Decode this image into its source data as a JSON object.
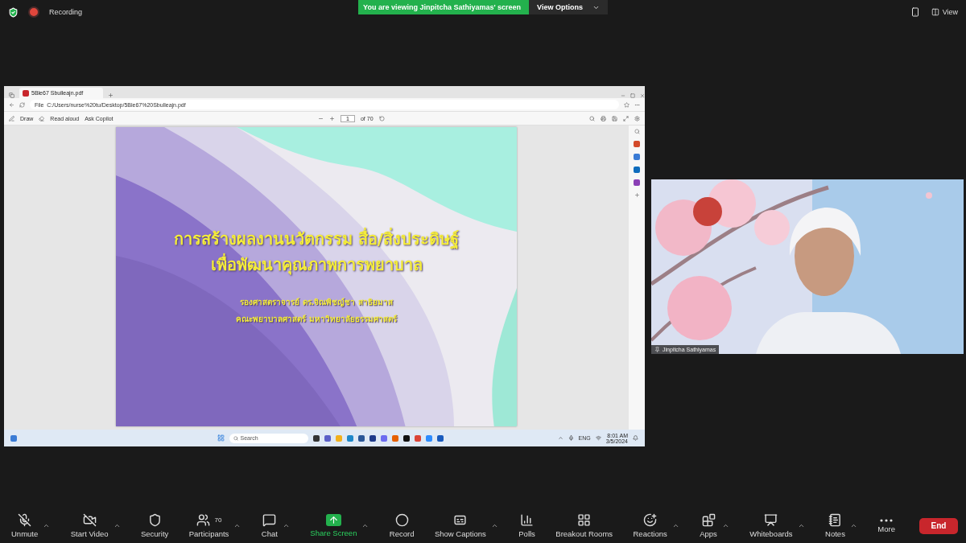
{
  "top_bar": {
    "recording_label": "Recording",
    "viewing_banner": "You are viewing Jinpitcha Sathiyamas' screen",
    "view_options": "View Options",
    "view_button": "View"
  },
  "shared_screen": {
    "browser": {
      "tab_title": "5Ble67 Sbulleajn.pdf",
      "address_prefix": "File",
      "address": "C:/Users/nurse%20tu/Desktop/5Ble67%20Sbulleajn.pdf",
      "draw": "Draw",
      "read_aloud": "Read aloud",
      "ask_copilot": "Ask Copilot",
      "page": "1",
      "page_total": "of 70"
    },
    "slide": {
      "title_lines": [
        "การสร้างผลงานนวัตกรรม สื่อ/สิ่งประดิษฐ์",
        "เพื่อพัฒนาคุณภาพการพยาบาล"
      ],
      "author": "รองศาสตราจารย์ ดร.จิณพิชญ์ชา  สาธิยมาส",
      "faculty": "คณะพยาบาลศาสตร์ มหาวิทยาลัยธรรมศาสตร์"
    },
    "taskbar": {
      "search_placeholder": "Search",
      "language": "ENG",
      "time": "8:01 AM",
      "date": "3/5/2024"
    }
  },
  "video": {
    "kind": "picture",
    "name": "Jinpitcha Sathiyamas"
  },
  "toolbar": {
    "items": [
      {
        "label": "Unmute",
        "kind": "mic-off",
        "caret": true,
        "active": false
      },
      {
        "label": "Start Video",
        "kind": "video-off",
        "caret": true,
        "active": false
      },
      {
        "label": "Security",
        "kind": "shield",
        "caret": false,
        "active": false
      },
      {
        "label": "Participants",
        "kind": "users",
        "count": "70",
        "caret": true,
        "active": false
      },
      {
        "label": "Chat",
        "kind": "chat",
        "caret": true,
        "active": false
      },
      {
        "label": "Share Screen",
        "kind": "share",
        "caret": true,
        "active": true
      },
      {
        "label": "Record",
        "kind": "record",
        "caret": false,
        "active": false
      },
      {
        "label": "Show Captions",
        "kind": "captions",
        "caret": true,
        "active": false
      },
      {
        "label": "Polls",
        "kind": "polls",
        "caret": false,
        "active": false
      },
      {
        "label": "Breakout Rooms",
        "kind": "grid",
        "caret": false,
        "active": false
      },
      {
        "label": "Reactions",
        "kind": "smile",
        "caret": true,
        "active": false
      },
      {
        "label": "Apps",
        "kind": "apps",
        "caret": true,
        "active": false
      },
      {
        "label": "Whiteboards",
        "kind": "whiteboard",
        "caret": true,
        "active": false
      },
      {
        "label": "Notes",
        "kind": "notes",
        "caret": true,
        "active": false
      },
      {
        "label": "More",
        "kind": "more",
        "caret": false,
        "active": false
      }
    ],
    "end": "End"
  }
}
